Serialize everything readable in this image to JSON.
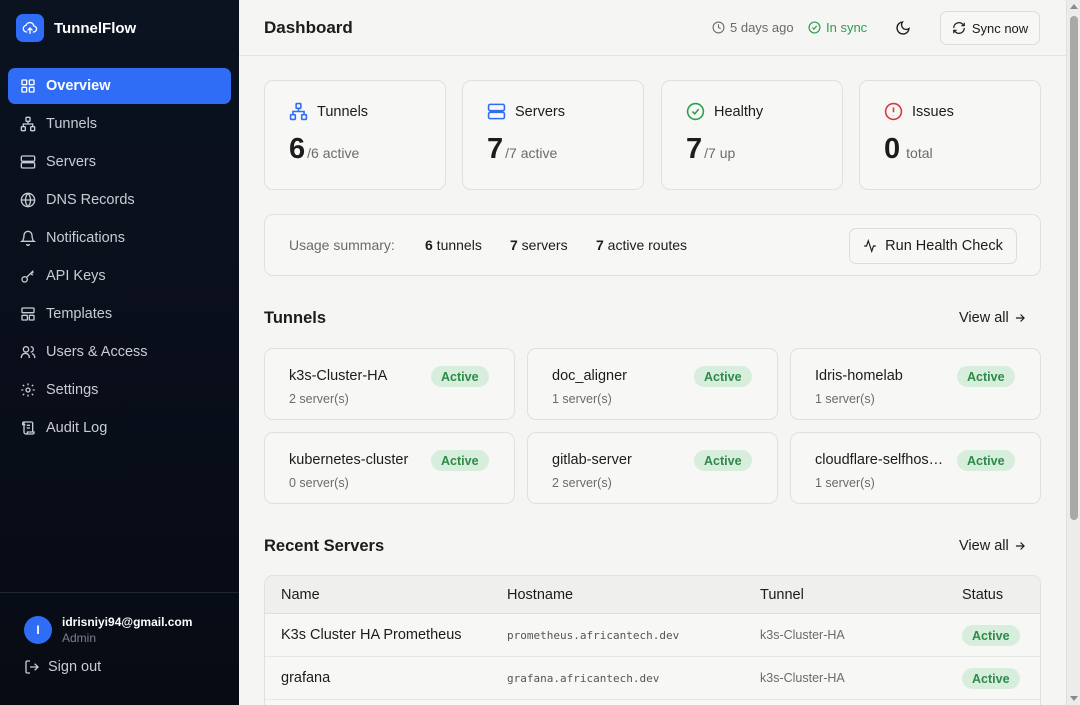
{
  "app": {
    "name": "TunnelFlow"
  },
  "sidebar": {
    "items": [
      {
        "label": "Overview",
        "icon": "grid-icon",
        "active": true
      },
      {
        "label": "Tunnels",
        "icon": "network-icon"
      },
      {
        "label": "Servers",
        "icon": "server-icon"
      },
      {
        "label": "DNS Records",
        "icon": "globe-icon"
      },
      {
        "label": "Notifications",
        "icon": "bell-icon"
      },
      {
        "label": "API Keys",
        "icon": "key-icon"
      },
      {
        "label": "Templates",
        "icon": "layout-icon"
      },
      {
        "label": "Users & Access",
        "icon": "users-icon"
      },
      {
        "label": "Settings",
        "icon": "gear-icon"
      },
      {
        "label": "Audit Log",
        "icon": "scroll-icon"
      }
    ],
    "user": {
      "initial": "I",
      "email": "idrisniyi94@gmail.com",
      "role": "Admin"
    },
    "signout_label": "Sign out"
  },
  "header": {
    "title": "Dashboard",
    "last_sync": "5 days ago",
    "sync_status": "In sync",
    "sync_button": "Sync now"
  },
  "stats": [
    {
      "label": "Tunnels",
      "value": "6",
      "sub": "/6 active",
      "icon": "network-icon",
      "color": "#2f6df6"
    },
    {
      "label": "Servers",
      "value": "7",
      "sub": "/7 active",
      "icon": "server-icon",
      "color": "#2f6df6"
    },
    {
      "label": "Healthy",
      "value": "7",
      "sub": "/7 up",
      "icon": "check-circle-icon",
      "color": "#2e9d4e"
    },
    {
      "label": "Issues",
      "value": "0",
      "sub": "total",
      "icon": "alert-circle-icon",
      "color": "#d9363e"
    }
  ],
  "usage": {
    "label": "Usage summary:",
    "tunnels_count": "6",
    "tunnels_label": " tunnels",
    "servers_count": "7",
    "servers_label": " servers",
    "routes_count": "7",
    "routes_label": " active routes",
    "health_button": "Run Health Check"
  },
  "tunnels_section": {
    "title": "Tunnels",
    "view_all": "View all",
    "items": [
      {
        "name": "k3s-Cluster-HA",
        "servers": "2 server(s)",
        "status": "Active"
      },
      {
        "name": "doc_aligner",
        "servers": "1 server(s)",
        "status": "Active"
      },
      {
        "name": "Idris-homelab",
        "servers": "1 server(s)",
        "status": "Active"
      },
      {
        "name": "kubernetes-cluster",
        "servers": "0 server(s)",
        "status": "Active"
      },
      {
        "name": "gitlab-server",
        "servers": "2 server(s)",
        "status": "Active"
      },
      {
        "name": "cloudflare-selfhosted",
        "servers": "1 server(s)",
        "status": "Active"
      }
    ]
  },
  "servers_section": {
    "title": "Recent Servers",
    "view_all": "View all",
    "columns": [
      "Name",
      "Hostname",
      "Tunnel",
      "Status"
    ],
    "rows": [
      {
        "name": "K3s Cluster HA Prometheus",
        "hostname": "prometheus.africantech.dev",
        "tunnel": "k3s-Cluster-HA",
        "status": "Active"
      },
      {
        "name": "grafana",
        "hostname": "grafana.africantech.dev",
        "tunnel": "k3s-Cluster-HA",
        "status": "Active"
      }
    ]
  },
  "colors": {
    "accent": "#2f6df6",
    "success": "#2e9d4e",
    "danger": "#d9363e",
    "sidebar_bg": "#0b1220"
  }
}
